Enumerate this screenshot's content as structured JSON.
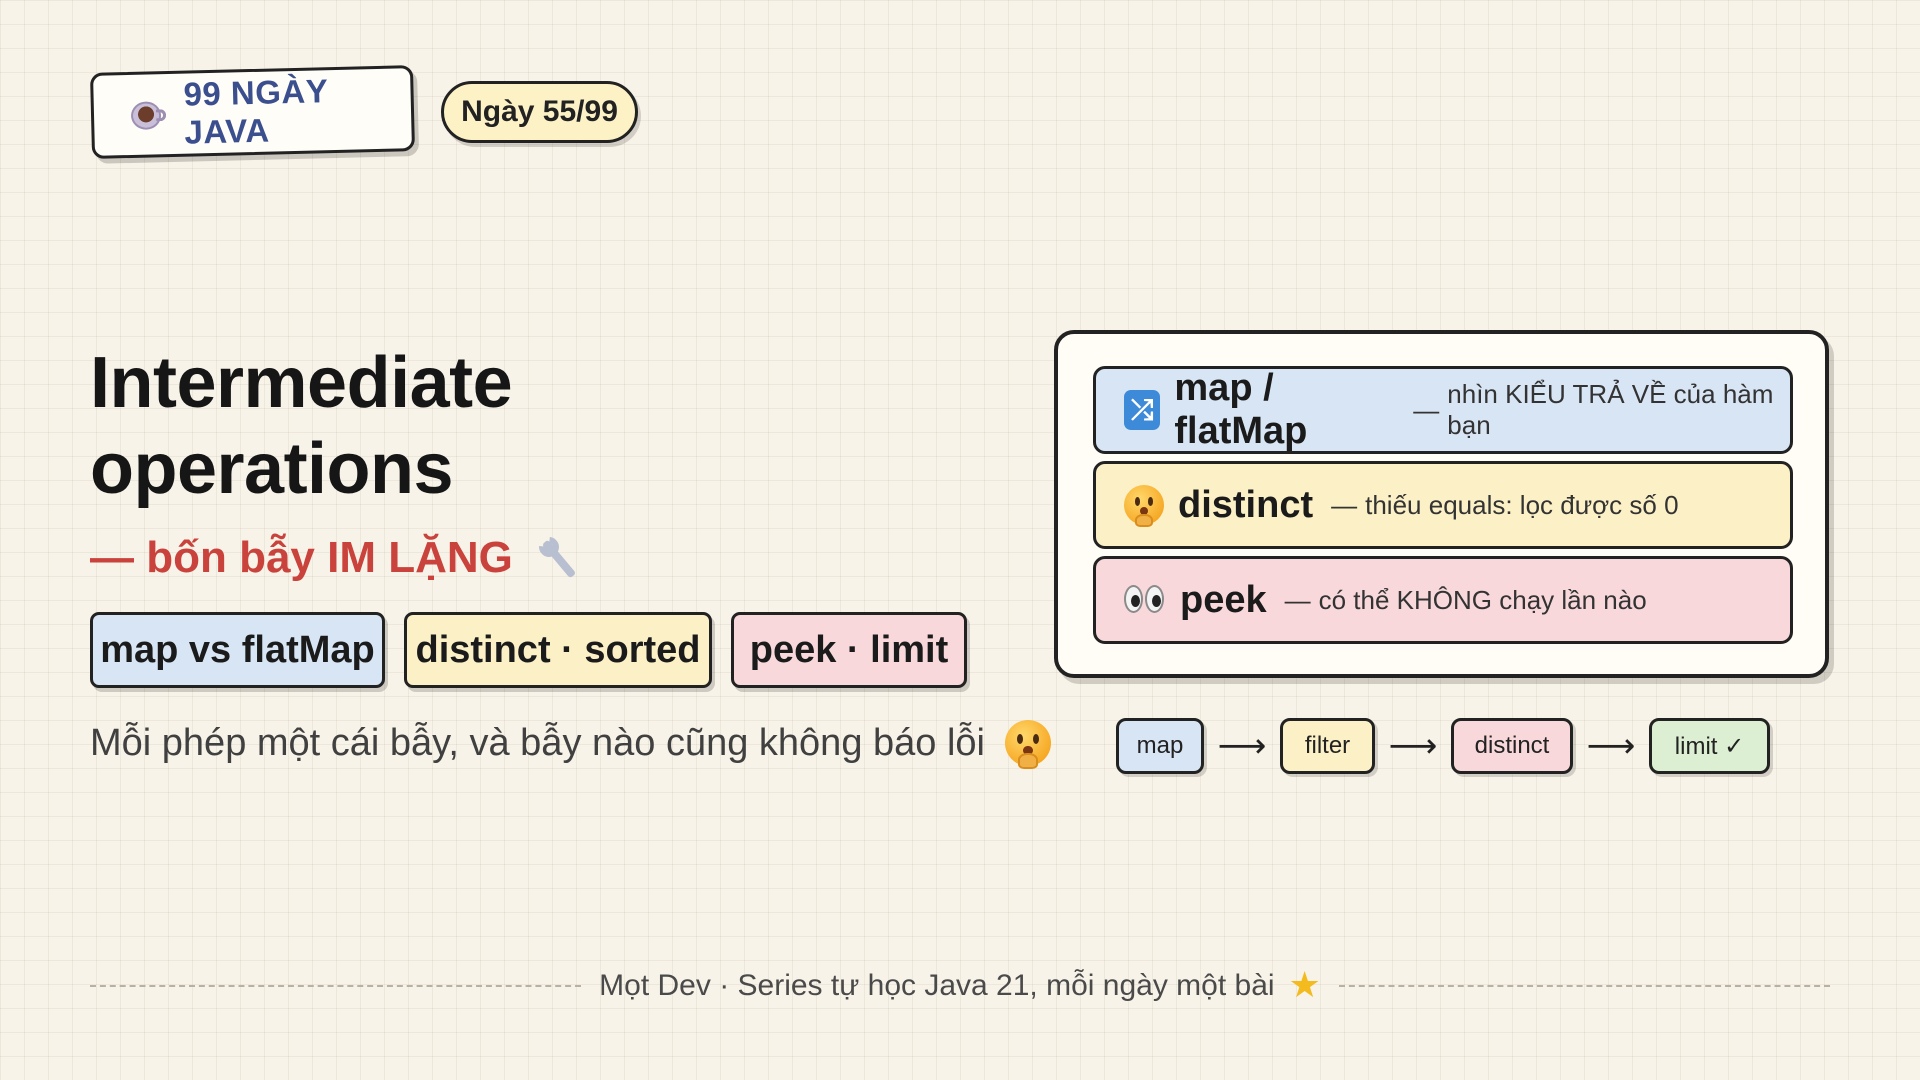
{
  "header": {
    "brand_icon": "coffee-cup-icon",
    "brand_label": "99 NGÀY JAVA",
    "day_label": "Ngày 55/99"
  },
  "main": {
    "title_line1": "Intermediate",
    "title_line2": "operations",
    "subtitle": "— bốn bẫy IM LẶNG",
    "subtitle_icon": "wrench-icon",
    "tags": [
      {
        "label": "map vs flatMap",
        "color": "#d7e5f4"
      },
      {
        "label": "distinct · sorted",
        "color": "#fcf0c6"
      },
      {
        "label": "peek · limit",
        "color": "#f8d8db"
      }
    ],
    "description": "Mỗi phép một cái bẫy, và bẫy nào cũng không báo lỗi",
    "description_icon": "shushing-face-icon"
  },
  "card": {
    "rows": [
      {
        "icon": "shuffle-icon",
        "name": "map / flatMap",
        "dash": "—",
        "note": "nhìn KIỂU TRẢ VỀ của hàm bạn"
      },
      {
        "icon": "shushing-face-icon",
        "name": "distinct",
        "dash": "—",
        "note": "thiếu equals: lọc được số 0"
      },
      {
        "icon": "eyes-icon",
        "name": "peek",
        "dash": "—",
        "note": "có thể KHÔNG chạy lần nào"
      }
    ]
  },
  "pipeline": {
    "steps": [
      "map",
      "filter",
      "distinct",
      "limit ✓"
    ],
    "arrow": "⟶"
  },
  "footer": {
    "text": "Mọt Dev · Series tự học Java 21, mỗi ngày một bài",
    "icon": "star-icon"
  }
}
